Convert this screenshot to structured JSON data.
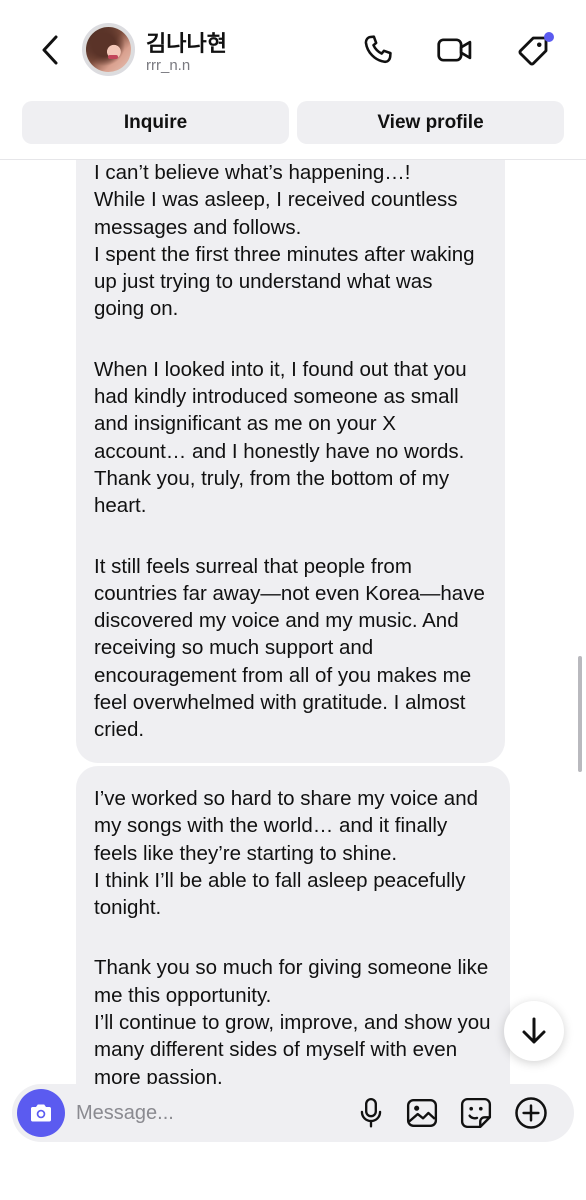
{
  "header": {
    "contact_name": "김나나현",
    "contact_handle": "rrr_n.n",
    "icons": {
      "back": "chevron-left-icon",
      "call": "phone-icon",
      "video": "video-camera-icon",
      "tag": "tag-icon"
    },
    "notification_dot_color": "#5b5bf0"
  },
  "actions": {
    "inquire_label": "Inquire",
    "view_profile_label": "View profile"
  },
  "messages": [
    {
      "paragraphs": [
        {
          "lines": [
            "I can’t believe what’s happening…!",
            "While I was asleep, I received countless messages and follows.",
            "I spent the first three minutes after waking up just trying to understand what was going on."
          ]
        },
        {
          "lines": [
            "When I looked into it, I found out that you had kindly introduced someone as small and insignificant as me on your X account… and I honestly have no words.",
            "Thank you, truly, from the bottom of my heart."
          ]
        },
        {
          "lines": [
            "It still feels surreal that people from countries far away—not even Korea—have discovered my voice and my music. And receiving so much support and encouragement from all of you makes me feel overwhelmed with gratitude. I almost cried."
          ]
        }
      ]
    },
    {
      "paragraphs": [
        {
          "lines": [
            "I’ve worked so hard to share my voice and my songs with the world… and it finally feels like they’re starting to shine.",
            "I think I’ll be able to fall asleep peacefully tonight."
          ]
        },
        {
          "lines": [
            "Thank you so much for giving someone like me this opportunity.",
            "I’ll continue to grow, improve, and show you many different sides of myself with even more passion."
          ]
        }
      ]
    }
  ],
  "composer": {
    "placeholder": "Message...",
    "value": "",
    "accent_color": "#5b5bf0",
    "icons": [
      "camera-icon",
      "microphone-icon",
      "gallery-icon",
      "sticker-icon",
      "plus-circle-icon"
    ]
  },
  "scroll_down_icon": "arrow-down-icon"
}
